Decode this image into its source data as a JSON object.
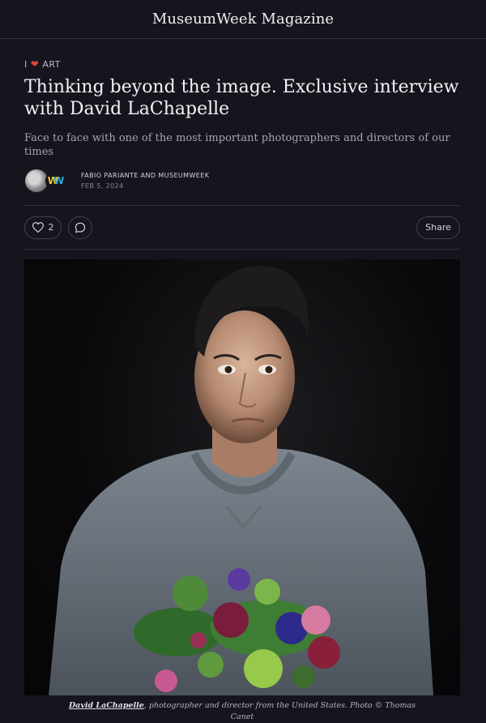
{
  "header": {
    "publication": "MuseumWeek Magazine"
  },
  "article": {
    "kicker_prefix": "I",
    "kicker_label": "ART",
    "title": "Thinking beyond the image. Exclusive interview with David LaChapelle",
    "subtitle": "Face to face with one of the most important photographers and directors of our times",
    "authors": "FABIO PARIANTE AND MUSEUMWEEK",
    "date": "FEB 5, 2024",
    "likes": "2",
    "share_label": "Share",
    "caption_name": "David LaChapelle",
    "caption_rest": ", photographer and director from the United States. Photo © Thomas Canet"
  },
  "icons": {
    "kicker": "heart-icon",
    "like": "heart-outline-icon",
    "comment": "comment-bubble-icon"
  },
  "colors": {
    "background": "#16141c",
    "heart": "#e0453e"
  }
}
